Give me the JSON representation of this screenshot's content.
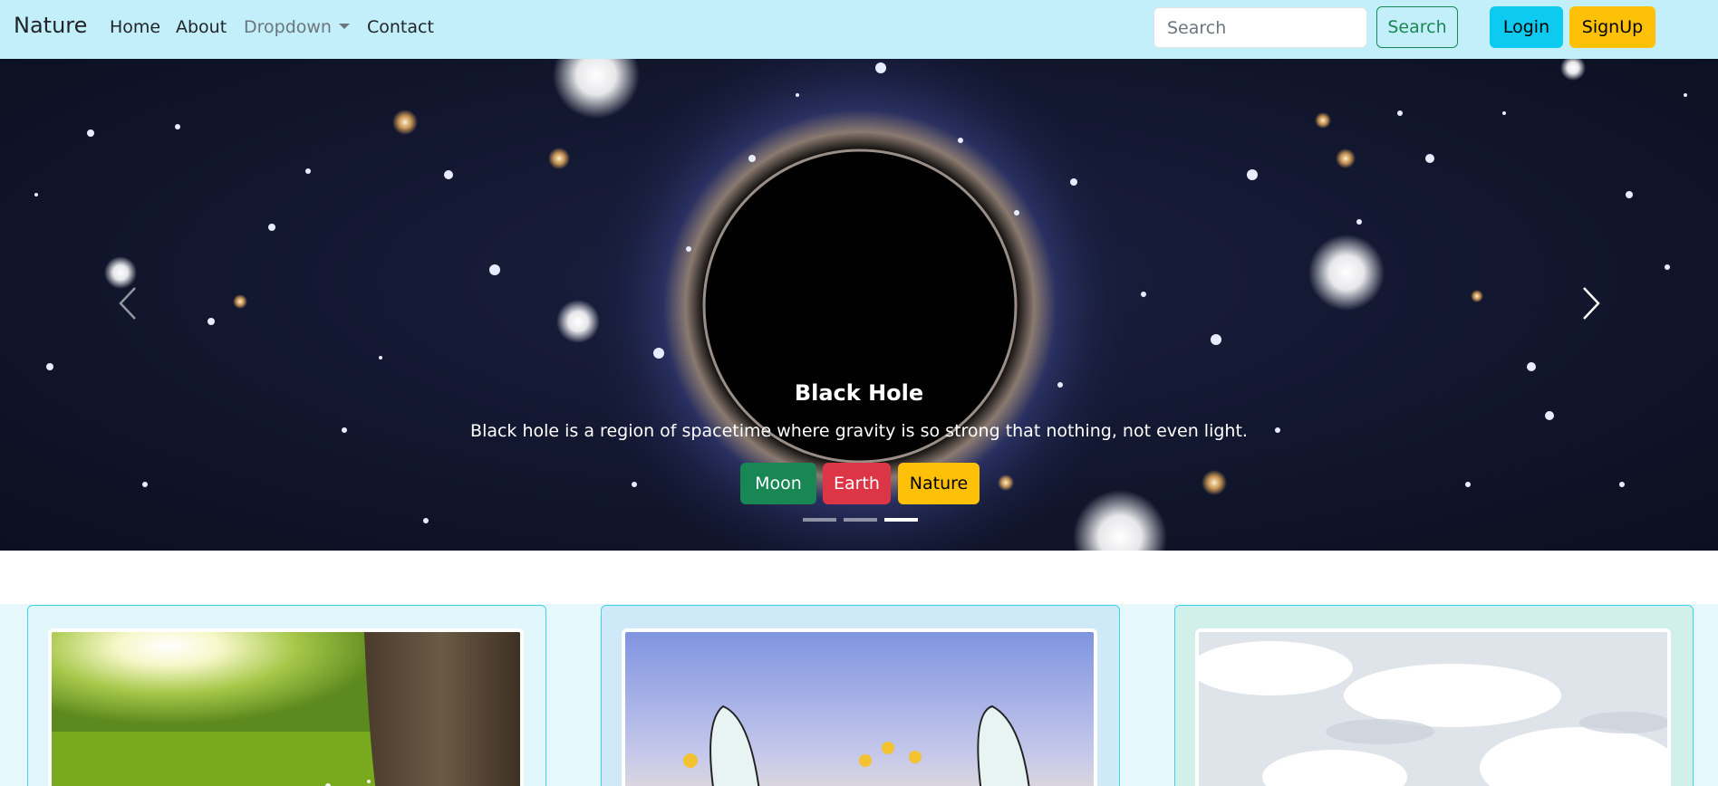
{
  "navbar": {
    "brand": "Nature",
    "links": [
      "Home",
      "About",
      "Dropdown",
      "Contact"
    ],
    "search": {
      "placeholder": "Search",
      "button": "Search"
    },
    "login": "Login",
    "signup": "SignUp",
    "background": "#c2eff9"
  },
  "carousel": {
    "caption_title": "Black Hole",
    "caption_text": "Black hole is a region of spacetime where gravity is so strong that nothing, not even light.",
    "tags": [
      "Moon",
      "Earth",
      "Nature"
    ],
    "slide_count": 3,
    "active_slide": 3,
    "icons": {
      "prev": "chevron-left-icon",
      "next": "chevron-right-icon"
    }
  },
  "colors": {
    "success": "#198754",
    "danger": "#dc3545",
    "warning": "#ffc107",
    "info": "#0dcaf0",
    "card_border": "#3fd3e8"
  }
}
